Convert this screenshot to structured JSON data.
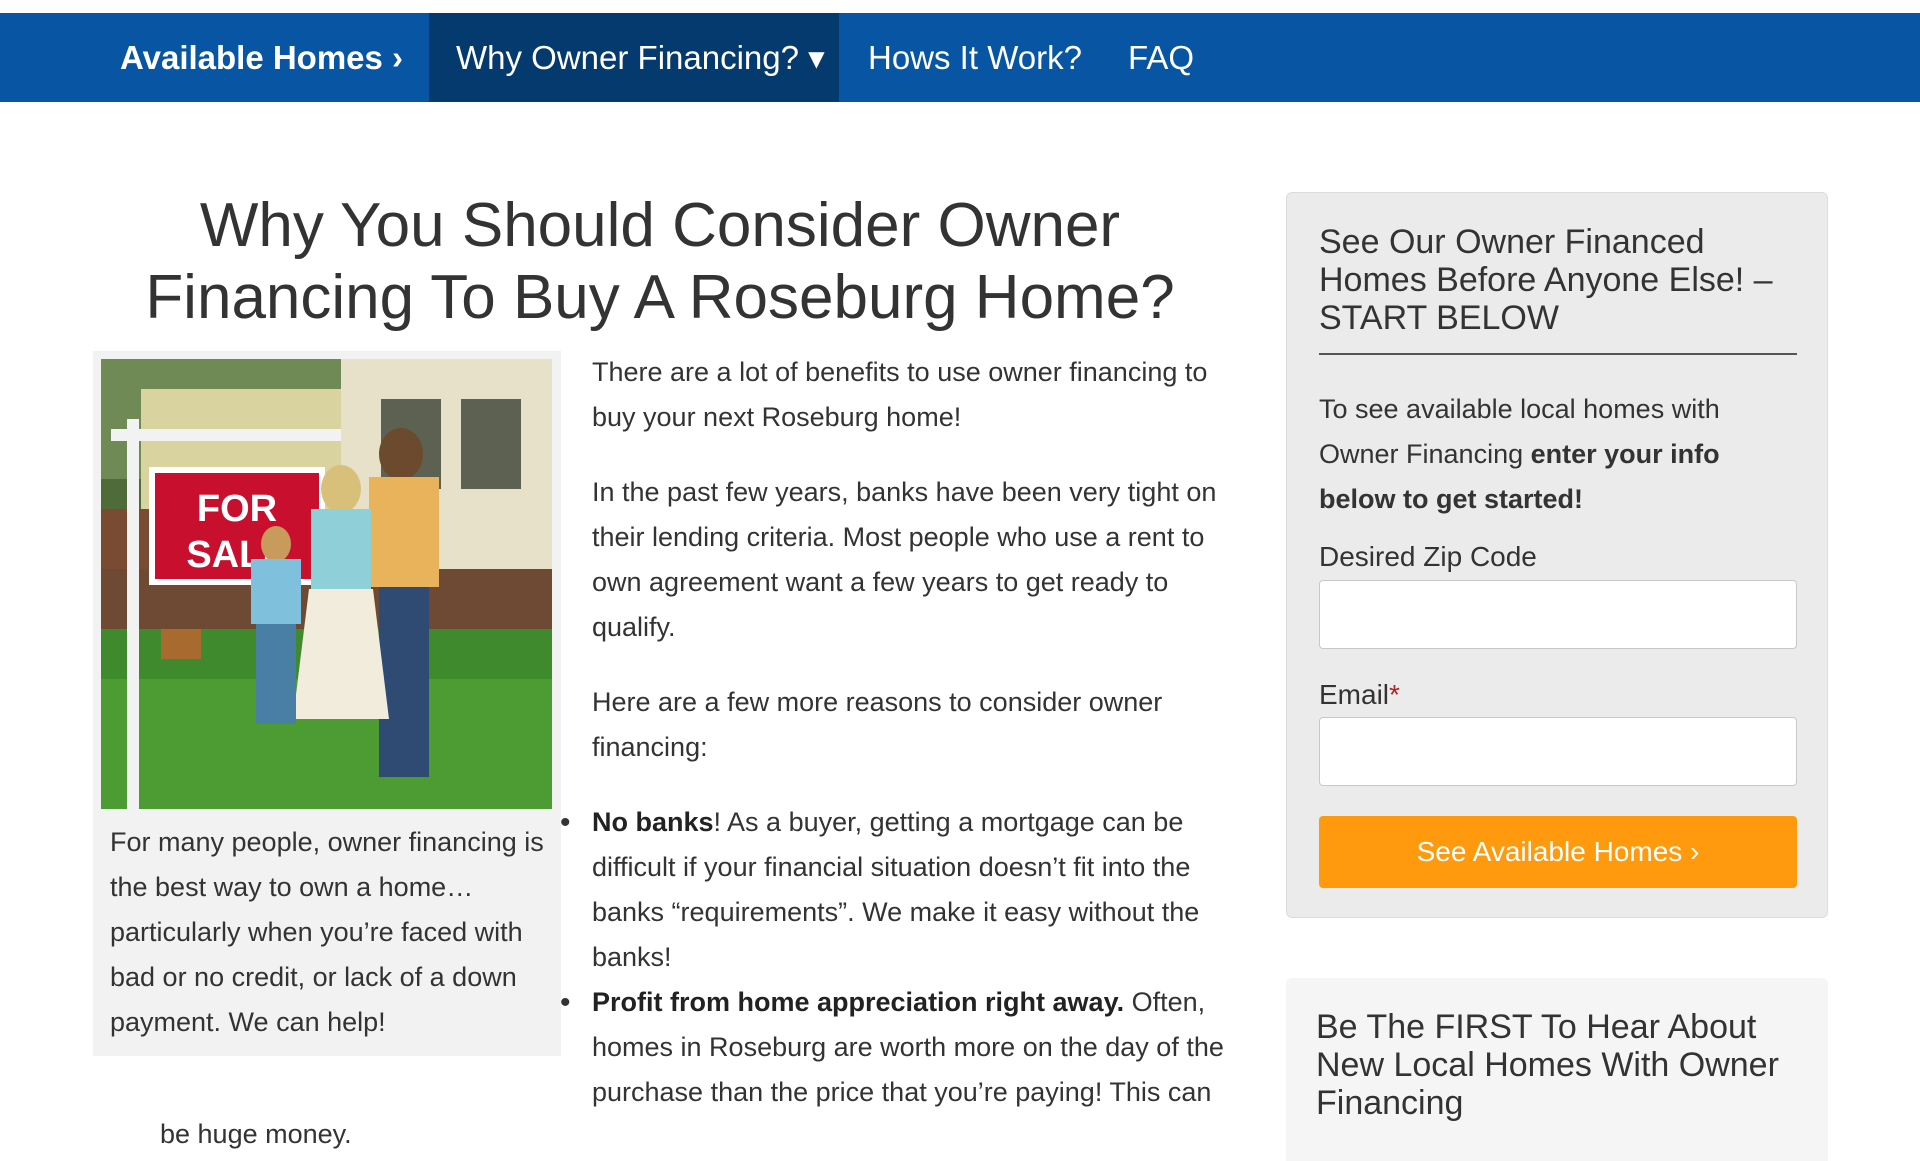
{
  "nav": {
    "items": [
      {
        "label": "Available Homes ›"
      },
      {
        "label": "Why Owner Financing? ▾"
      },
      {
        "label": "Hows It Work?"
      },
      {
        "label": "FAQ"
      }
    ]
  },
  "main": {
    "title": "Why You Should Consider Owner Financing To Buy A Roseburg Home?",
    "image_sign_text": [
      "FOR",
      "SALE"
    ],
    "caption": "For many people, owner financing is the best way to own a home… particularly when you’re faced with bad or no credit, or lack of a down payment. We can help!",
    "paragraphs": [
      "There are a lot of benefits to use owner financing to buy your next Roseburg home!",
      "In the past few years, banks have been very tight on their lending criteria. Most people who use a rent to own agreement want a few years to get ready to qualify.",
      "Here are a few more reasons to consider owner financing:"
    ],
    "bullets": [
      {
        "bold": "No banks",
        "text": "!  As a buyer, getting a mortgage can be difficult if your financial situation doesn’t fit into the banks “requirements”. We make it easy without the banks!"
      },
      {
        "bold": "Profit from home appreciation right away.",
        "text": " Often, homes in Roseburg are worth more on the day of the purchase than the price that you’re paying! This can"
      }
    ],
    "tail": "be huge money."
  },
  "sidebar": {
    "title": "See Our Owner Financed Homes Before Anyone Else! – START BELOW",
    "intro_plain": "To see available local homes with Owner Financing ",
    "intro_bold": "enter your info below to get started!",
    "zip_label": "Desired Zip Code",
    "zip_value": "",
    "email_label": "Email",
    "email_required": "*",
    "email_value": "",
    "cta_label": "See Available Homes ›"
  },
  "sidebar2": {
    "title": "Be The FIRST To Hear About New Local Homes With Owner Financing"
  },
  "colors": {
    "nav_bg": "#0755a3",
    "nav_active_bg": "#053a6e",
    "cta_bg": "#ff9a0f",
    "required": "#b41f1f"
  }
}
